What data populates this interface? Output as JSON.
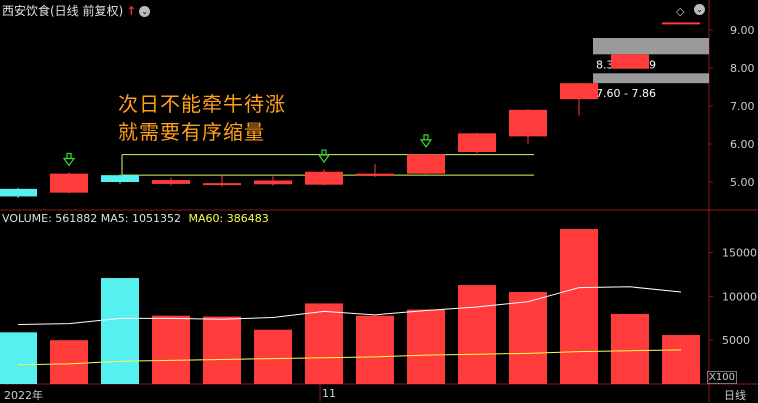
{
  "header": {
    "title": "西安饮食(日线 前复权)",
    "arrow": "↑",
    "dropdown": "⌄",
    "diamond": "◇",
    "settings": "⌄"
  },
  "annotation": {
    "line1": "次日不能牵牛待涨",
    "line2": "就需要有序缩量"
  },
  "volume_legend": {
    "volume": "VOLUME: 561882",
    "ma5": "MA5: 1051352",
    "ma60": "MA60: 386483"
  },
  "bottom": {
    "x100": "X100",
    "year_label": "2022年",
    "month_label": "11",
    "period": "日线"
  },
  "colors": {
    "background": "#000000",
    "up": "#ff3b3b",
    "down": "#55f0f0",
    "grid": "#8b1a1a",
    "ma5": "#ffffff",
    "ma60": "#ffff55",
    "box": "#ccff66",
    "arrow": "#33dd33",
    "zone": "#9a9a9a"
  },
  "chart_data": [
    {
      "type": "candlestick",
      "yticks": [
        5.0,
        6.0,
        7.0,
        8.0,
        9.0
      ],
      "ylim": [
        4.3,
        9.5
      ],
      "candles": [
        {
          "o": 4.82,
          "c": 4.62,
          "h": 4.85,
          "l": 4.58
        },
        {
          "o": 4.72,
          "c": 5.22,
          "h": 5.25,
          "l": 4.7
        },
        {
          "o": 5.18,
          "c": 5.0,
          "h": 5.2,
          "l": 4.95
        },
        {
          "o": 4.95,
          "c": 5.05,
          "h": 5.12,
          "l": 4.9
        },
        {
          "o": 4.93,
          "c": 4.97,
          "h": 5.18,
          "l": 4.88
        },
        {
          "o": 4.94,
          "c": 5.04,
          "h": 5.15,
          "l": 4.9
        },
        {
          "o": 4.93,
          "c": 5.27,
          "h": 5.34,
          "l": 4.91
        },
        {
          "o": 5.16,
          "c": 5.22,
          "h": 5.48,
          "l": 5.13
        },
        {
          "o": 5.22,
          "c": 5.73,
          "h": 5.74,
          "l": 5.2
        },
        {
          "o": 5.79,
          "c": 6.28,
          "h": 6.3,
          "l": 5.7
        },
        {
          "o": 6.2,
          "c": 6.9,
          "h": 6.92,
          "l": 6.0
        },
        {
          "o": 7.18,
          "c": 7.6,
          "h": 7.6,
          "l": 6.75
        },
        {
          "o": 7.98,
          "c": 8.36,
          "h": 8.36,
          "l": 7.98
        },
        {
          "o": 9.2,
          "c": 9.2,
          "h": 9.2,
          "l": 9.2
        }
      ],
      "zones": [
        {
          "low": 7.6,
          "high": 7.86,
          "label": "7.60 - 7.86"
        },
        {
          "low": 8.36,
          "high": 8.79,
          "label": "8.36 - 8.79"
        }
      ],
      "box": {
        "from_index": 2,
        "to_index": 10,
        "low": 5.18,
        "high": 5.72
      },
      "markers_at_index": [
        1,
        6,
        8
      ]
    },
    {
      "type": "bar",
      "yticks": [
        5000,
        10000,
        15000
      ],
      "ylim": [
        0,
        18500
      ],
      "unit": "X100",
      "values": [
        5900,
        5000,
        12100,
        7800,
        7700,
        6200,
        9200,
        7800,
        8500,
        11300,
        10500,
        17700,
        8000,
        5600
      ],
      "ma5": [
        6800,
        6900,
        7500,
        7500,
        7400,
        7600,
        8300,
        7900,
        8400,
        8800,
        9400,
        11000,
        11100,
        10500
      ],
      "ma60": [
        2200,
        2300,
        2600,
        2700,
        2800,
        2900,
        3000,
        3100,
        3300,
        3400,
        3500,
        3700,
        3800,
        3900
      ]
    }
  ]
}
